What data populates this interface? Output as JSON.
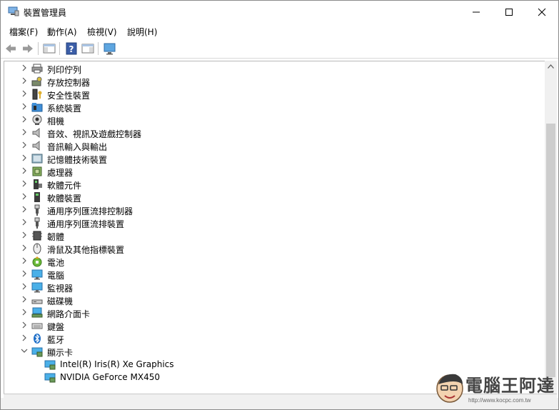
{
  "window": {
    "title": "裝置管理員"
  },
  "menu": [
    {
      "label": "檔案(F)"
    },
    {
      "label": "動作(A)"
    },
    {
      "label": "檢視(V)"
    },
    {
      "label": "說明(H)"
    }
  ],
  "tree": [
    {
      "label": "列印佇列",
      "icon": "printer-icon",
      "expanded": false
    },
    {
      "label": "存放控制器",
      "icon": "storage-controller-icon",
      "expanded": false
    },
    {
      "label": "安全性裝置",
      "icon": "security-key-icon",
      "expanded": false
    },
    {
      "label": "系統裝置",
      "icon": "system-folder-icon",
      "expanded": false
    },
    {
      "label": "相機",
      "icon": "camera-icon",
      "expanded": false
    },
    {
      "label": "音效、視訊及遊戲控制器",
      "icon": "speaker-icon",
      "expanded": false
    },
    {
      "label": "音訊輸入與輸出",
      "icon": "speaker-icon",
      "expanded": false
    },
    {
      "label": "記憶體技術裝置",
      "icon": "memory-device-icon",
      "expanded": false
    },
    {
      "label": "處理器",
      "icon": "processor-icon",
      "expanded": false
    },
    {
      "label": "軟體元件",
      "icon": "software-component-icon",
      "expanded": false
    },
    {
      "label": "軟體裝置",
      "icon": "software-device-icon",
      "expanded": false
    },
    {
      "label": "通用序列匯流排控制器",
      "icon": "usb-icon",
      "expanded": false
    },
    {
      "label": "通用序列匯流排裝置",
      "icon": "usb-icon",
      "expanded": false
    },
    {
      "label": "韌體",
      "icon": "firmware-icon",
      "expanded": false
    },
    {
      "label": "滑鼠及其他指標裝置",
      "icon": "mouse-icon",
      "expanded": false
    },
    {
      "label": "電池",
      "icon": "battery-icon",
      "expanded": false
    },
    {
      "label": "電腦",
      "icon": "computer-icon",
      "expanded": false
    },
    {
      "label": "監視器",
      "icon": "monitor-icon",
      "expanded": false
    },
    {
      "label": "磁碟機",
      "icon": "disk-drive-icon",
      "expanded": false
    },
    {
      "label": "網路介面卡",
      "icon": "network-adapter-icon",
      "expanded": false
    },
    {
      "label": "鍵盤",
      "icon": "keyboard-icon",
      "expanded": false
    },
    {
      "label": "藍牙",
      "icon": "bluetooth-icon",
      "expanded": false
    },
    {
      "label": "顯示卡",
      "icon": "display-adapter-icon",
      "expanded": true
    },
    {
      "label": "Intel(R) Iris(R) Xe Graphics",
      "icon": "display-adapter-icon",
      "child": true
    },
    {
      "label": "NVIDIA GeForce MX450",
      "icon": "display-adapter-icon",
      "child": true
    }
  ],
  "watermark": {
    "name": "電腦王阿達",
    "url": "http://www.kocpc.com.tw"
  }
}
